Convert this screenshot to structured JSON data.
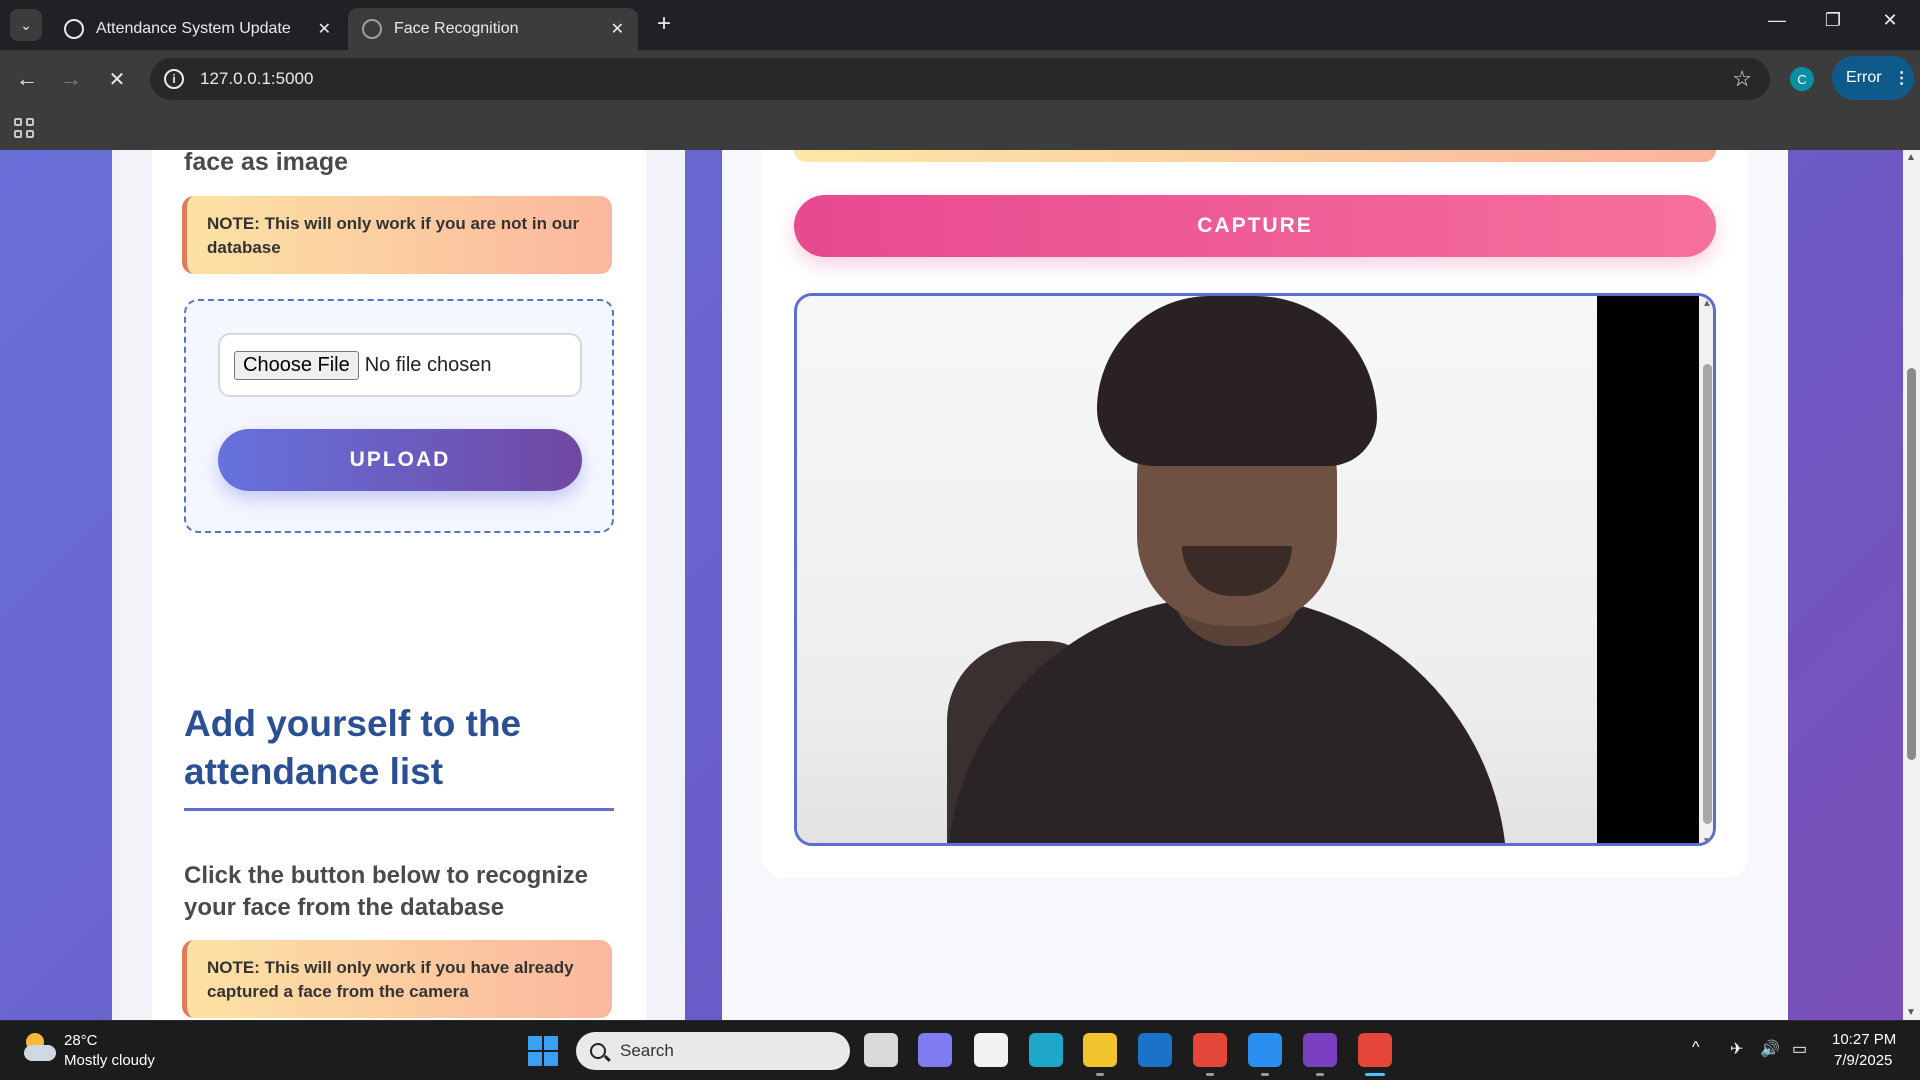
{
  "browser": {
    "tabs": [
      {
        "title": "Attendance System Update",
        "close": "✕"
      },
      {
        "title": "Face Recognition",
        "close": "✕"
      }
    ],
    "new_tab": "+",
    "window_controls": {
      "minimize": "—",
      "restore": "❐",
      "close": "✕"
    },
    "nav": {
      "back": "←",
      "forward": "→",
      "stop": "✕"
    },
    "url": "127.0.0.1:5000",
    "info_glyph": "i",
    "bookmark_glyph": "☆",
    "profile_initial": "C",
    "error_label": "Error",
    "menu_glyph": "⋮"
  },
  "page": {
    "upload_section": {
      "heading_tail": "face as image",
      "note": "NOTE: This will only work if you are not in our database",
      "file_button": "Choose File",
      "file_status": "No file chosen",
      "upload_button": "UPLOAD"
    },
    "add_section": {
      "title": "Add yourself to the attendance list",
      "description": "Click the button below to recognize your face from the database",
      "note": "NOTE: This will only work if you have already captured a face from the camera"
    },
    "camera_section": {
      "capture_button": "CAPTURE"
    }
  },
  "taskbar": {
    "weather_temp": "28°C",
    "weather_condition": "Mostly cloudy",
    "search_label": "Search",
    "tray": {
      "chevron": "^",
      "network": "✈",
      "volume": "🔊",
      "battery": "▭"
    },
    "time": "10:27 PM",
    "date": "7/9/2025",
    "apps": [
      {
        "name": "task-view-icon",
        "color": "#d9d9d9"
      },
      {
        "name": "copilot-icon",
        "color": "#7f7cf2"
      },
      {
        "name": "store-icon",
        "color": "#f2f2f2"
      },
      {
        "name": "edge-icon",
        "color": "#1fa7c9"
      },
      {
        "name": "file-explorer-icon",
        "color": "#f4c430"
      },
      {
        "name": "outlook-icon",
        "color": "#1a73c9"
      },
      {
        "name": "chrome-profile-icon",
        "color": "#e5463a"
      },
      {
        "name": "vscode-icon",
        "color": "#2a8ff0"
      },
      {
        "name": "github-desktop-icon",
        "color": "#7b3fc2"
      },
      {
        "name": "chrome-icon",
        "color": "#e5463a"
      }
    ]
  }
}
